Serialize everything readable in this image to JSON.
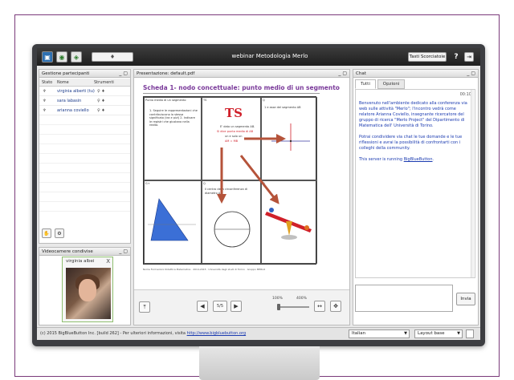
{
  "window": {
    "title": "webinar Metodologia Merlo"
  },
  "toolbar": {
    "shortcuts_label": "Tasti Scorciatoie",
    "help_label": "?",
    "mic_icon": "microphone-icon",
    "logout_icon": "logout-icon"
  },
  "participants": {
    "title": "Gestione partecipanti",
    "col_status": "Stato",
    "col_name": "Nome",
    "col_tools": "Strumenti",
    "rows": [
      {
        "name": "virginia alberti (tu)"
      },
      {
        "name": "sara labasin"
      },
      {
        "name": "arianna coviello"
      }
    ]
  },
  "webcams": {
    "title": "Videocamere condivise",
    "user_name": "virginia albei",
    "close": "X"
  },
  "presentation": {
    "title": "Presentazione: default.pdf",
    "slide_title": "Scheda 1- nodo concettuale: punto medio di un segmento",
    "page": "5/5",
    "zoom_min": "100%",
    "zoom_max": "400%",
    "grid": {
      "c1_head": "Punto medio di un segmento",
      "c2_head": "TS",
      "c3_head": "Q",
      "c1_text": "1. Seguire le rappresentazioni che contribuiscono la stessa significato (tra e pizl) 2. Indivare le registri che giustano nella realta.",
      "c2_ts": "TS",
      "c2_text1": "E' dato un segmento AB.",
      "c2_text2": "Si dice punto medio di AB",
      "c2_text3": "un e solo un",
      "c2_text4": "AM = MB",
      "c3_text": "1 e asse del segmento AB",
      "c4_head": "G+",
      "c5_head": "Q",
      "c6_head": "Q",
      "c5_text": "Il centro della circonferenza di diametro AB",
      "footnote": "Nome Formazioni Didattica Matematica · 2014-2015 · Università degli studi di Torino · Gruppo MERLO"
    }
  },
  "chat": {
    "title": "Chat",
    "tab_all": "Tutti",
    "tab_options": "Opzioni",
    "time": "00:10",
    "msg1": "Benvenuto nell'ambiente dedicato alla conferenza via web sulle attività \"Merlo\"; l'incontro vedrà come relatore Arianna Coviello, insegnante ricercatore del gruppo di ricerca \"Merlo Project\" del Dipartimento di Matematica dell' Università di Torino.",
    "msg2": "Potrai condividere via chat le tue domande e le tue riflessioni e avrai la possibilità di confrontarti con i colleghi della community.",
    "msg3_prefix": "This server is running ",
    "msg3_link": "BigBlueButton",
    "msg3_suffix": ".",
    "send_label": "Invia"
  },
  "statusbar": {
    "copyright": "(c) 2015 BigBlueButton Inc. [build 262] - Per ulteriori informazioni, visita ",
    "link": "http://www.bigbluebutton.org",
    "language": "Italian",
    "layout": "Layout base"
  },
  "colors": {
    "frame_border": "#7a3a7a",
    "monitor": "#3d3e42",
    "slide_title": "#7a3a9a",
    "ts_red": "#d0202a",
    "arrow_brown": "#b5533a",
    "chat_blue": "#1a3ab0"
  }
}
